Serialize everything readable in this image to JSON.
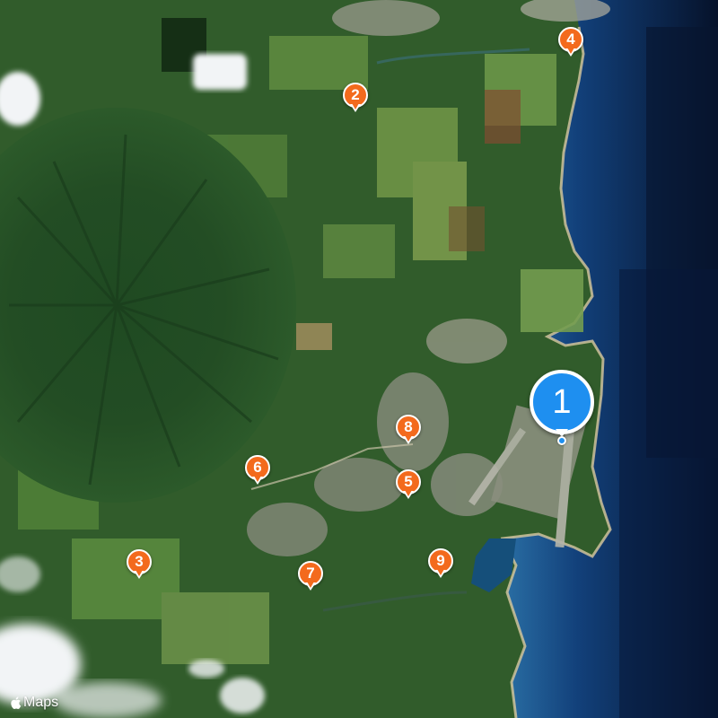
{
  "map": {
    "style": "satellite",
    "colors": {
      "marker": "#f36a1d",
      "marker_border": "#ffffff",
      "selected_marker": "#1e8ff0",
      "ocean_deep": "#07152f",
      "ocean_shallow": "#1d5a8c",
      "land": "#2f5a2a"
    }
  },
  "markers": [
    {
      "label": "1",
      "selected": true
    },
    {
      "label": "2"
    },
    {
      "label": "3"
    },
    {
      "label": "4"
    },
    {
      "label": "5"
    },
    {
      "label": "6"
    },
    {
      "label": "7"
    },
    {
      "label": "8"
    },
    {
      "label": "9"
    }
  ],
  "attribution": {
    "icon": "apple-logo-icon",
    "label": "Maps"
  }
}
